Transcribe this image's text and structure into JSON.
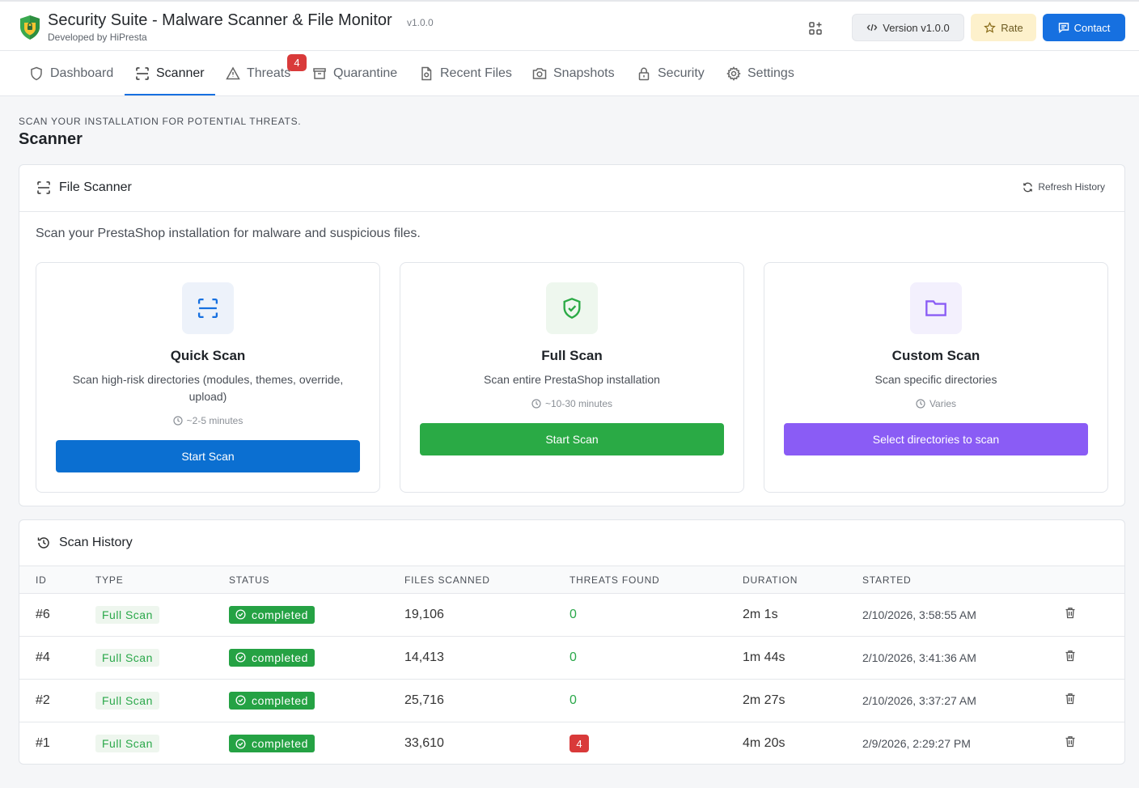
{
  "header": {
    "title": "Security Suite - Malware Scanner & File Monitor",
    "version_tag": "v1.0.0",
    "subtitle": "Developed by HiPresta",
    "version_button": "Version v1.0.0",
    "rate_button": "Rate",
    "contact_button": "Contact"
  },
  "tabs": [
    {
      "label": "Dashboard",
      "icon": "shield-icon"
    },
    {
      "label": "Scanner",
      "icon": "scan-icon",
      "active": true
    },
    {
      "label": "Threats",
      "icon": "warning-icon",
      "badge": "4"
    },
    {
      "label": "Quarantine",
      "icon": "archive-icon"
    },
    {
      "label": "Recent Files",
      "icon": "file-icon"
    },
    {
      "label": "Snapshots",
      "icon": "camera-icon"
    },
    {
      "label": "Security",
      "icon": "lock-icon"
    },
    {
      "label": "Settings",
      "icon": "gear-icon"
    }
  ],
  "page": {
    "eyebrow": "SCAN YOUR INSTALLATION FOR POTENTIAL THREATS.",
    "title": "Scanner"
  },
  "file_scanner": {
    "title": "File Scanner",
    "refresh_label": "Refresh History",
    "description": "Scan your PrestaShop installation for malware and suspicious files.",
    "cards": [
      {
        "title": "Quick Scan",
        "desc": "Scan high-risk directories (modules, themes, override, upload)",
        "time": "~2-5 minutes",
        "button": "Start Scan",
        "accent": "#1670e0",
        "icon_bg": "#edf2fa"
      },
      {
        "title": "Full Scan",
        "desc": "Scan entire PrestaShop installation",
        "time": "~10-30 minutes",
        "button": "Start Scan",
        "accent": "#2aaa45",
        "icon_bg": "#eef7ee"
      },
      {
        "title": "Custom Scan",
        "desc": "Scan specific directories",
        "time": "Varies",
        "button": "Select directories to scan",
        "accent": "#8a5cf5",
        "icon_bg": "#f3f0fd"
      }
    ]
  },
  "history": {
    "title": "Scan History",
    "columns": [
      "ID",
      "TYPE",
      "STATUS",
      "FILES SCANNED",
      "THREATS FOUND",
      "DURATION",
      "STARTED"
    ],
    "rows": [
      {
        "id": "#6",
        "type": "Full Scan",
        "status": "completed",
        "files": "19,106",
        "threats": "0",
        "duration": "2m 1s",
        "started": "2/10/2026, 3:58:55 AM"
      },
      {
        "id": "#4",
        "type": "Full Scan",
        "status": "completed",
        "files": "14,413",
        "threats": "0",
        "duration": "1m 44s",
        "started": "2/10/2026, 3:41:36 AM"
      },
      {
        "id": "#2",
        "type": "Full Scan",
        "status": "completed",
        "files": "25,716",
        "threats": "0",
        "duration": "2m 27s",
        "started": "2/10/2026, 3:37:27 AM"
      },
      {
        "id": "#1",
        "type": "Full Scan",
        "status": "completed",
        "files": "33,610",
        "threats": "4",
        "duration": "4m 20s",
        "started": "2/9/2026, 2:29:27 PM"
      }
    ]
  }
}
